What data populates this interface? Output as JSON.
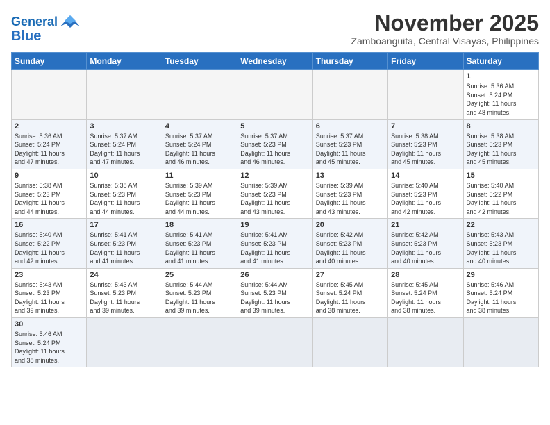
{
  "logo": {
    "line1": "General",
    "line2": "Blue"
  },
  "title": "November 2025",
  "location": "Zamboanguita, Central Visayas, Philippines",
  "days_of_week": [
    "Sunday",
    "Monday",
    "Tuesday",
    "Wednesday",
    "Thursday",
    "Friday",
    "Saturday"
  ],
  "weeks": [
    [
      {
        "day": "",
        "info": ""
      },
      {
        "day": "",
        "info": ""
      },
      {
        "day": "",
        "info": ""
      },
      {
        "day": "",
        "info": ""
      },
      {
        "day": "",
        "info": ""
      },
      {
        "day": "",
        "info": ""
      },
      {
        "day": "1",
        "info": "Sunrise: 5:36 AM\nSunset: 5:24 PM\nDaylight: 11 hours\nand 48 minutes."
      }
    ],
    [
      {
        "day": "2",
        "info": "Sunrise: 5:36 AM\nSunset: 5:24 PM\nDaylight: 11 hours\nand 47 minutes."
      },
      {
        "day": "3",
        "info": "Sunrise: 5:37 AM\nSunset: 5:24 PM\nDaylight: 11 hours\nand 47 minutes."
      },
      {
        "day": "4",
        "info": "Sunrise: 5:37 AM\nSunset: 5:24 PM\nDaylight: 11 hours\nand 46 minutes."
      },
      {
        "day": "5",
        "info": "Sunrise: 5:37 AM\nSunset: 5:23 PM\nDaylight: 11 hours\nand 46 minutes."
      },
      {
        "day": "6",
        "info": "Sunrise: 5:37 AM\nSunset: 5:23 PM\nDaylight: 11 hours\nand 45 minutes."
      },
      {
        "day": "7",
        "info": "Sunrise: 5:38 AM\nSunset: 5:23 PM\nDaylight: 11 hours\nand 45 minutes."
      },
      {
        "day": "8",
        "info": "Sunrise: 5:38 AM\nSunset: 5:23 PM\nDaylight: 11 hours\nand 45 minutes."
      }
    ],
    [
      {
        "day": "9",
        "info": "Sunrise: 5:38 AM\nSunset: 5:23 PM\nDaylight: 11 hours\nand 44 minutes."
      },
      {
        "day": "10",
        "info": "Sunrise: 5:38 AM\nSunset: 5:23 PM\nDaylight: 11 hours\nand 44 minutes."
      },
      {
        "day": "11",
        "info": "Sunrise: 5:39 AM\nSunset: 5:23 PM\nDaylight: 11 hours\nand 44 minutes."
      },
      {
        "day": "12",
        "info": "Sunrise: 5:39 AM\nSunset: 5:23 PM\nDaylight: 11 hours\nand 43 minutes."
      },
      {
        "day": "13",
        "info": "Sunrise: 5:39 AM\nSunset: 5:23 PM\nDaylight: 11 hours\nand 43 minutes."
      },
      {
        "day": "14",
        "info": "Sunrise: 5:40 AM\nSunset: 5:23 PM\nDaylight: 11 hours\nand 42 minutes."
      },
      {
        "day": "15",
        "info": "Sunrise: 5:40 AM\nSunset: 5:22 PM\nDaylight: 11 hours\nand 42 minutes."
      }
    ],
    [
      {
        "day": "16",
        "info": "Sunrise: 5:40 AM\nSunset: 5:22 PM\nDaylight: 11 hours\nand 42 minutes."
      },
      {
        "day": "17",
        "info": "Sunrise: 5:41 AM\nSunset: 5:23 PM\nDaylight: 11 hours\nand 41 minutes."
      },
      {
        "day": "18",
        "info": "Sunrise: 5:41 AM\nSunset: 5:23 PM\nDaylight: 11 hours\nand 41 minutes."
      },
      {
        "day": "19",
        "info": "Sunrise: 5:41 AM\nSunset: 5:23 PM\nDaylight: 11 hours\nand 41 minutes."
      },
      {
        "day": "20",
        "info": "Sunrise: 5:42 AM\nSunset: 5:23 PM\nDaylight: 11 hours\nand 40 minutes."
      },
      {
        "day": "21",
        "info": "Sunrise: 5:42 AM\nSunset: 5:23 PM\nDaylight: 11 hours\nand 40 minutes."
      },
      {
        "day": "22",
        "info": "Sunrise: 5:43 AM\nSunset: 5:23 PM\nDaylight: 11 hours\nand 40 minutes."
      }
    ],
    [
      {
        "day": "23",
        "info": "Sunrise: 5:43 AM\nSunset: 5:23 PM\nDaylight: 11 hours\nand 39 minutes."
      },
      {
        "day": "24",
        "info": "Sunrise: 5:43 AM\nSunset: 5:23 PM\nDaylight: 11 hours\nand 39 minutes."
      },
      {
        "day": "25",
        "info": "Sunrise: 5:44 AM\nSunset: 5:23 PM\nDaylight: 11 hours\nand 39 minutes."
      },
      {
        "day": "26",
        "info": "Sunrise: 5:44 AM\nSunset: 5:23 PM\nDaylight: 11 hours\nand 39 minutes."
      },
      {
        "day": "27",
        "info": "Sunrise: 5:45 AM\nSunset: 5:24 PM\nDaylight: 11 hours\nand 38 minutes."
      },
      {
        "day": "28",
        "info": "Sunrise: 5:45 AM\nSunset: 5:24 PM\nDaylight: 11 hours\nand 38 minutes."
      },
      {
        "day": "29",
        "info": "Sunrise: 5:46 AM\nSunset: 5:24 PM\nDaylight: 11 hours\nand 38 minutes."
      }
    ],
    [
      {
        "day": "30",
        "info": "Sunrise: 5:46 AM\nSunset: 5:24 PM\nDaylight: 11 hours\nand 38 minutes."
      },
      {
        "day": "",
        "info": ""
      },
      {
        "day": "",
        "info": ""
      },
      {
        "day": "",
        "info": ""
      },
      {
        "day": "",
        "info": ""
      },
      {
        "day": "",
        "info": ""
      },
      {
        "day": "",
        "info": ""
      }
    ]
  ]
}
